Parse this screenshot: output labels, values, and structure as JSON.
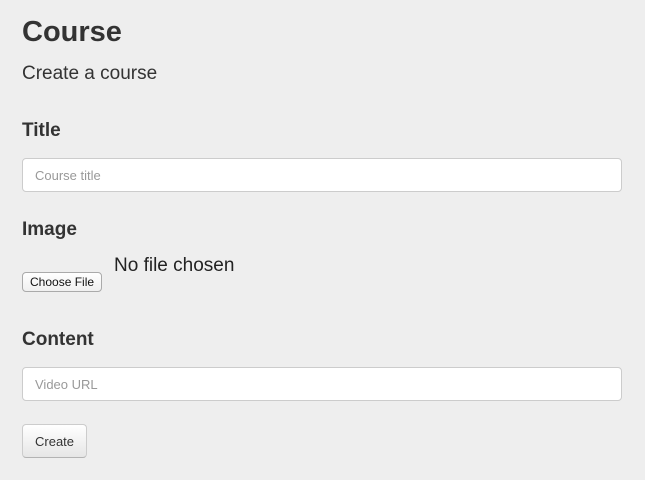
{
  "header": {
    "title": "Course",
    "subtitle": "Create a course"
  },
  "form": {
    "title_section": {
      "label": "Title",
      "placeholder": "Course title",
      "value": ""
    },
    "image_section": {
      "label": "Image",
      "choose_file_label": "Choose File",
      "file_status": "No file chosen"
    },
    "content_section": {
      "label": "Content",
      "placeholder": "Video URL",
      "value": ""
    },
    "submit_label": "Create"
  }
}
